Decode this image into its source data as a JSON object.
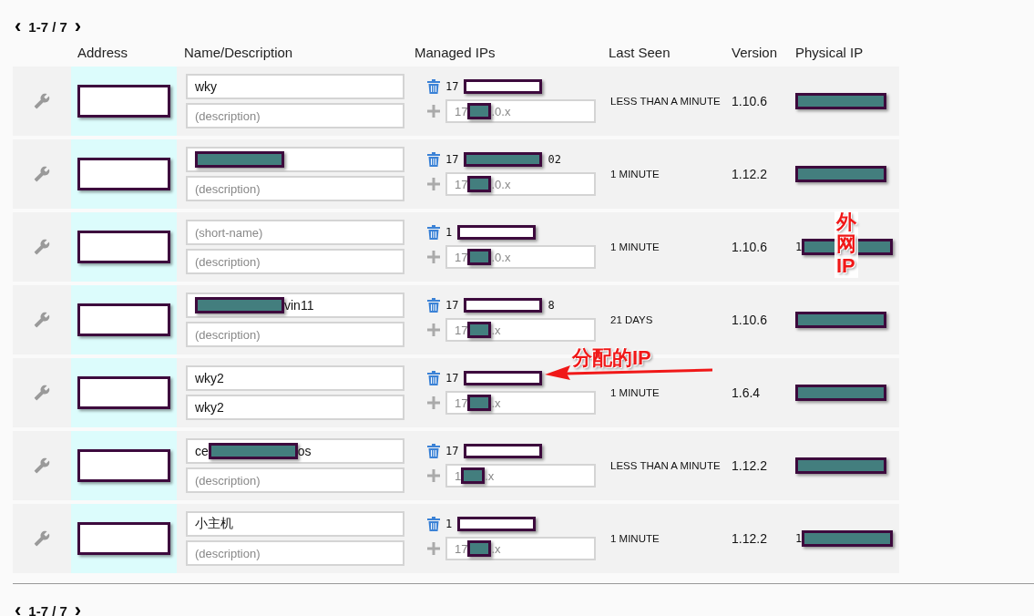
{
  "pager_top": {
    "prev": "‹",
    "range": "1-7 / 7",
    "next": "›"
  },
  "columns": [
    "Address",
    "Name/Description",
    "Managed IPs",
    "Last Seen",
    "Version",
    "Physical IP"
  ],
  "rows": [
    {
      "address": [
        {
          "kind": "redaction",
          "color": "#ffffff"
        }
      ],
      "name": {
        "parts": [
          {
            "kind": "text",
            "text": "wky"
          }
        ]
      },
      "description": {
        "placeholder": "(description)"
      },
      "managed_ip": [
        {
          "kind": "text",
          "text": "17"
        },
        {
          "kind": "redaction",
          "color": "#ffffff"
        }
      ],
      "new_ip": [
        {
          "kind": "text",
          "text": "17"
        },
        {
          "kind": "redaction",
          "color": "#437e7e"
        },
        {
          "kind": "text",
          "text": ".0.x"
        }
      ],
      "last_seen": "LESS THAN A MINUTE",
      "version": "1.10.6",
      "physical_ip": [
        {
          "kind": "redaction",
          "color": "#437e7e"
        }
      ]
    },
    {
      "address": [
        {
          "kind": "redaction",
          "color": "#ffffff"
        }
      ],
      "name": {
        "parts": [
          {
            "kind": "redaction",
            "color": "#437e7e"
          }
        ]
      },
      "description": {
        "placeholder": "(description)"
      },
      "managed_ip": [
        {
          "kind": "text",
          "text": "17"
        },
        {
          "kind": "redaction",
          "color": "#437e7e"
        },
        {
          "kind": "text",
          "text": "02"
        }
      ],
      "new_ip": [
        {
          "kind": "text",
          "text": "17"
        },
        {
          "kind": "redaction",
          "color": "#437e7e"
        },
        {
          "kind": "text",
          "text": ".0.x"
        }
      ],
      "last_seen": "1 MINUTE",
      "version": "1.12.2",
      "physical_ip": [
        {
          "kind": "redaction",
          "color": "#437e7e"
        }
      ]
    },
    {
      "address": [
        {
          "kind": "redaction",
          "color": "#ffffff"
        }
      ],
      "name": {
        "placeholder": "(short-name)"
      },
      "description": {
        "placeholder": "(description)"
      },
      "managed_ip": [
        {
          "kind": "text",
          "text": "1"
        },
        {
          "kind": "redaction",
          "color": "#ffffff"
        }
      ],
      "new_ip": [
        {
          "kind": "text",
          "text": "17"
        },
        {
          "kind": "redaction",
          "color": "#437e7e"
        },
        {
          "kind": "text",
          "text": ".0.x"
        }
      ],
      "last_seen": "1 MINUTE",
      "version": "1.10.6",
      "physical_ip": [
        {
          "kind": "text",
          "text": "1"
        },
        {
          "kind": "redaction",
          "color": "#437e7e"
        }
      ]
    },
    {
      "address": [
        {
          "kind": "redaction",
          "color": "#ffffff"
        }
      ],
      "name": {
        "parts": [
          {
            "kind": "redaction",
            "color": "#437e7e"
          },
          {
            "kind": "text",
            "text": "vin11"
          }
        ]
      },
      "description": {
        "placeholder": "(description)"
      },
      "managed_ip": [
        {
          "kind": "text",
          "text": "17"
        },
        {
          "kind": "redaction",
          "color": "#ffffff"
        },
        {
          "kind": "text",
          "text": "8"
        }
      ],
      "new_ip": [
        {
          "kind": "text",
          "text": "17"
        },
        {
          "kind": "redaction",
          "color": "#437e7e"
        },
        {
          "kind": "text",
          "text": ".x"
        }
      ],
      "last_seen": "21 DAYS",
      "version": "1.10.6",
      "physical_ip": [
        {
          "kind": "redaction",
          "color": "#437e7e"
        }
      ]
    },
    {
      "address": [
        {
          "kind": "redaction",
          "color": "#ffffff"
        }
      ],
      "name": {
        "parts": [
          {
            "kind": "text",
            "text": "wky2"
          }
        ]
      },
      "description": {
        "value": "wky2"
      },
      "managed_ip": [
        {
          "kind": "text",
          "text": "17"
        },
        {
          "kind": "redaction",
          "color": "#ffffff"
        }
      ],
      "new_ip": [
        {
          "kind": "text",
          "text": "17"
        },
        {
          "kind": "redaction",
          "color": "#437e7e"
        },
        {
          "kind": "text",
          "text": ".x"
        }
      ],
      "last_seen": "1 MINUTE",
      "version": "1.6.4",
      "physical_ip": [
        {
          "kind": "redaction",
          "color": "#437e7e"
        }
      ]
    },
    {
      "address": [
        {
          "kind": "redaction",
          "color": "#ffffff"
        }
      ],
      "name": {
        "parts": [
          {
            "kind": "text",
            "text": "ce"
          },
          {
            "kind": "redaction",
            "color": "#437e7e"
          },
          {
            "kind": "text",
            "text": "os"
          }
        ]
      },
      "description": {
        "placeholder": "(description)"
      },
      "managed_ip": [
        {
          "kind": "text",
          "text": "17"
        },
        {
          "kind": "redaction",
          "color": "#ffffff"
        }
      ],
      "new_ip": [
        {
          "kind": "text",
          "text": "1"
        },
        {
          "kind": "redaction",
          "color": "#437e7e"
        },
        {
          "kind": "text",
          "text": ".x"
        }
      ],
      "last_seen": "LESS THAN A MINUTE",
      "version": "1.12.2",
      "physical_ip": [
        {
          "kind": "redaction",
          "color": "#437e7e"
        }
      ]
    },
    {
      "address": [
        {
          "kind": "redaction",
          "color": "#ffffff"
        }
      ],
      "name": {
        "parts": [
          {
            "kind": "text",
            "text": "小主机"
          }
        ]
      },
      "description": {
        "placeholder": "(description)"
      },
      "managed_ip": [
        {
          "kind": "text",
          "text": "1"
        },
        {
          "kind": "redaction",
          "color": "#ffffff"
        }
      ],
      "new_ip": [
        {
          "kind": "text",
          "text": "17"
        },
        {
          "kind": "redaction",
          "color": "#437e7e"
        },
        {
          "kind": "text",
          "text": ".x"
        }
      ],
      "last_seen": "1 MINUTE",
      "version": "1.12.2",
      "physical_ip": [
        {
          "kind": "text",
          "text": "1"
        },
        {
          "kind": "redaction",
          "color": "#437e7e"
        }
      ]
    }
  ],
  "pager_bottom": {
    "prev": "‹",
    "range": "1-7 / 7",
    "next": "›"
  },
  "annotations": [
    {
      "kind": "vertical",
      "text": "外网IP"
    },
    {
      "kind": "arrow",
      "text": "分配的IP"
    }
  ]
}
